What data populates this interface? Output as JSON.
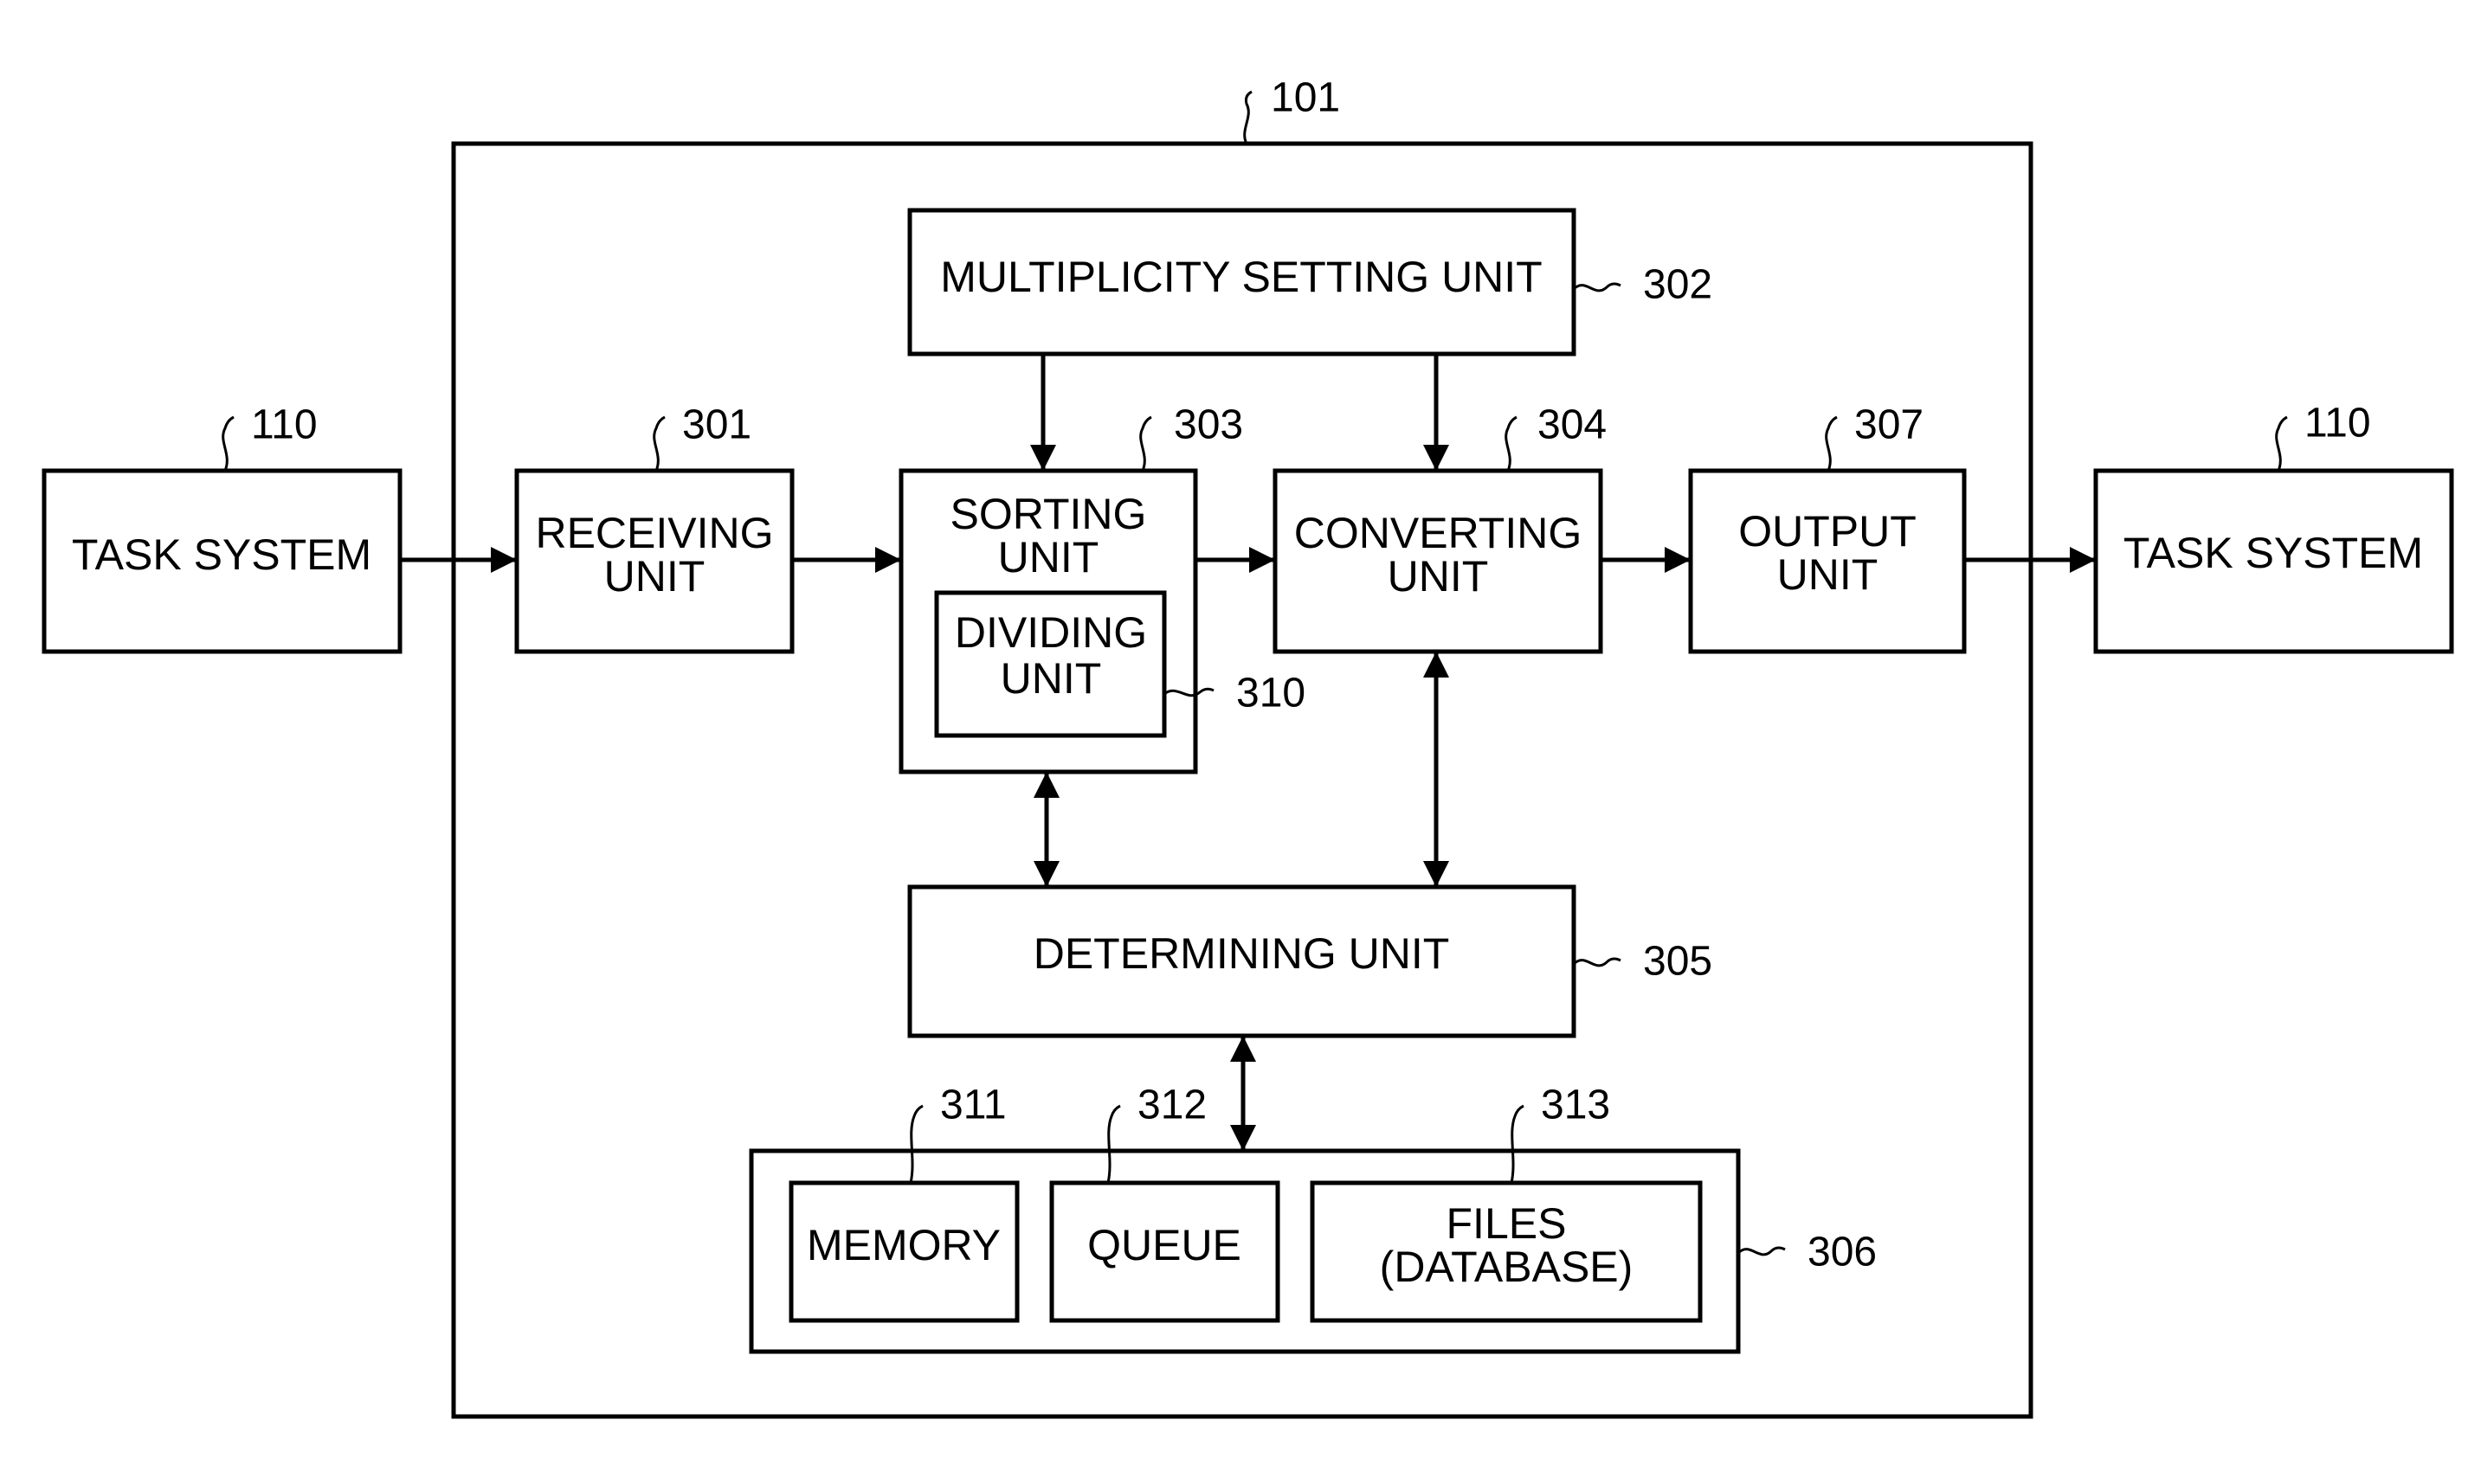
{
  "diagram": {
    "type": "block-diagram",
    "system": {
      "ref": "101"
    },
    "blocks": {
      "task_system_left": {
        "ref": "110",
        "lines": [
          "TASK SYSTEM"
        ]
      },
      "receiving": {
        "ref": "301",
        "lines": [
          "RECEIVING",
          "UNIT"
        ]
      },
      "multiplicity": {
        "ref": "302",
        "lines": [
          "MULTIPLICITY SETTING UNIT"
        ]
      },
      "sorting": {
        "ref": "303",
        "lines": [
          "SORTING",
          "UNIT"
        ]
      },
      "dividing": {
        "ref": "310",
        "lines": [
          "DIVIDING",
          "UNIT"
        ]
      },
      "converting": {
        "ref": "304",
        "lines": [
          "CONVERTING",
          "UNIT"
        ]
      },
      "output": {
        "ref": "307",
        "lines": [
          "OUTPUT",
          "UNIT"
        ]
      },
      "task_system_right": {
        "ref": "110",
        "lines": [
          "TASK SYSTEM"
        ]
      },
      "determining": {
        "ref": "305",
        "lines": [
          "DETERMINING UNIT"
        ]
      },
      "storage": {
        "ref": "306"
      },
      "memory": {
        "ref": "311",
        "lines": [
          "MEMORY"
        ]
      },
      "queue": {
        "ref": "312",
        "lines": [
          "QUEUE"
        ]
      },
      "files": {
        "ref": "313",
        "lines": [
          "FILES",
          "(DATABASE)"
        ]
      }
    },
    "connections": [
      {
        "from": "task_system_left",
        "to": "receiving",
        "direction": "forward"
      },
      {
        "from": "receiving",
        "to": "sorting",
        "direction": "forward"
      },
      {
        "from": "sorting",
        "to": "converting",
        "direction": "forward"
      },
      {
        "from": "converting",
        "to": "output",
        "direction": "forward"
      },
      {
        "from": "output",
        "to": "task_system_right",
        "direction": "forward"
      },
      {
        "from": "multiplicity",
        "to": "sorting",
        "direction": "forward"
      },
      {
        "from": "multiplicity",
        "to": "converting",
        "direction": "forward"
      },
      {
        "from": "sorting",
        "to": "determining",
        "direction": "bidirectional"
      },
      {
        "from": "converting",
        "to": "determining",
        "direction": "bidirectional"
      },
      {
        "from": "determining",
        "to": "storage",
        "direction": "bidirectional"
      }
    ]
  }
}
